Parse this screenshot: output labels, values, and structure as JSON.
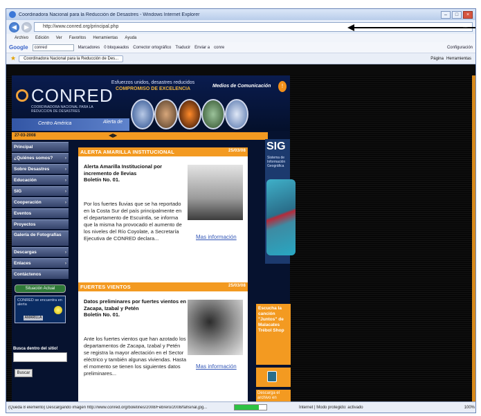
{
  "browser": {
    "window_title": "Coordinadora Nacional para la Reducción de Desastres - Windows Internet Explorer",
    "url": "http://www.conred.org/principal.php",
    "url_ghost": "…",
    "menu": [
      "Archivo",
      "Edición",
      "Ver",
      "Favoritos",
      "Herramientas",
      "Ayuda"
    ],
    "google_label": "Google",
    "google_query": "conred",
    "toolbar_items": [
      "Marcadores",
      "0 bloqueados",
      "Corrector ortográfico",
      "Traducir",
      "Enviar a",
      "conre"
    ],
    "config_label": "Configuración",
    "tab_title": "Coordinadora Nacional para la Reducción de Des...",
    "right_tools": [
      "Página",
      "Herramientas"
    ]
  },
  "site": {
    "logo": "CONRED",
    "logo_sub": "COORDINADORA NACIONAL PARA LA REDUCCION DE DESASTRES",
    "tagline": "Esfuerzos unidos, desastres reducidos",
    "tagline_bold": "COMPROMISO DE EXCELENCIA",
    "media_label": "Medios de Comunicación",
    "band_left": "Centro América",
    "band_right": "Alerta de",
    "date": "27-03-2008",
    "sidebar": [
      {
        "label": "Principal",
        "chev": ""
      },
      {
        "label": "¿Quiénes somos?",
        "chev": "›"
      },
      {
        "label": "Sobre Desastres",
        "chev": "›"
      },
      {
        "label": "Educación",
        "chev": "›"
      },
      {
        "label": "SIG",
        "chev": "›"
      },
      {
        "label": "Cooperación",
        "chev": "›"
      },
      {
        "label": "Eventos",
        "chev": ""
      },
      {
        "label": "Proyectos",
        "chev": ""
      },
      {
        "label": "Galería de Fotografías",
        "chev": ""
      },
      {
        "label": "Descargas",
        "chev": "›"
      },
      {
        "label": "Enlaces",
        "chev": "›"
      },
      {
        "label": "Contáctenos",
        "chev": ""
      }
    ],
    "situation_badge": "Situación Actual",
    "alert_box": "CONRED se encuentra en alerta",
    "alert_btn": "AMARILLA",
    "search_label": "Busca dentro del sitio!",
    "search_button": "Buscar",
    "news": [
      {
        "header": "ALERTA AMARILLA INSTITUCIONAL",
        "date": "25/03/08",
        "title": "Alerta Amarilla Institucional por incremento de llevias",
        "bulletin": "Boletín No. 01.",
        "body": "Por los fuertes lluvias que se ha reportado en la Costa Sur del país principalmente en el departamento de Escuintla, se informa que la misma ha provocado el aumento de los niveles del Río Coyolate, a Secretaría Ejecutiva de CONRED declara...",
        "more": "Mas información"
      },
      {
        "header": "FUERTES VIENTOS",
        "date": "25/03/08",
        "title": "Datos preliminares por fuertes vientos en Zacapa, Izabal y Petén",
        "bulletin": "Boletín No. 01.",
        "body": "Ante los fuertes vientos que han azotado los departamentos de Zacapa, Izabal y Petén se registra la mayor afectación en el Sector eléctrico y también algunas viviendas. Hasta el momento se tienen los siguientes datos preliminares...",
        "more": "Mas información"
      }
    ],
    "sig_title": "SIG",
    "sig_sub": "Sistema de Información Geográfica",
    "promo": "Escucha la canción \"Juntos\" de Malacates Trébol Shop",
    "promo2": "Descarga el archivo en"
  },
  "status": {
    "message": "(Queda 8 elemento) Descargando imagen http://www.conred.org/boletines/2008/Febrero/2008/fahsinal.jpg...",
    "progress": 0.75,
    "zone": "Internet | Modo protegido: activado",
    "zoom": "100%"
  }
}
